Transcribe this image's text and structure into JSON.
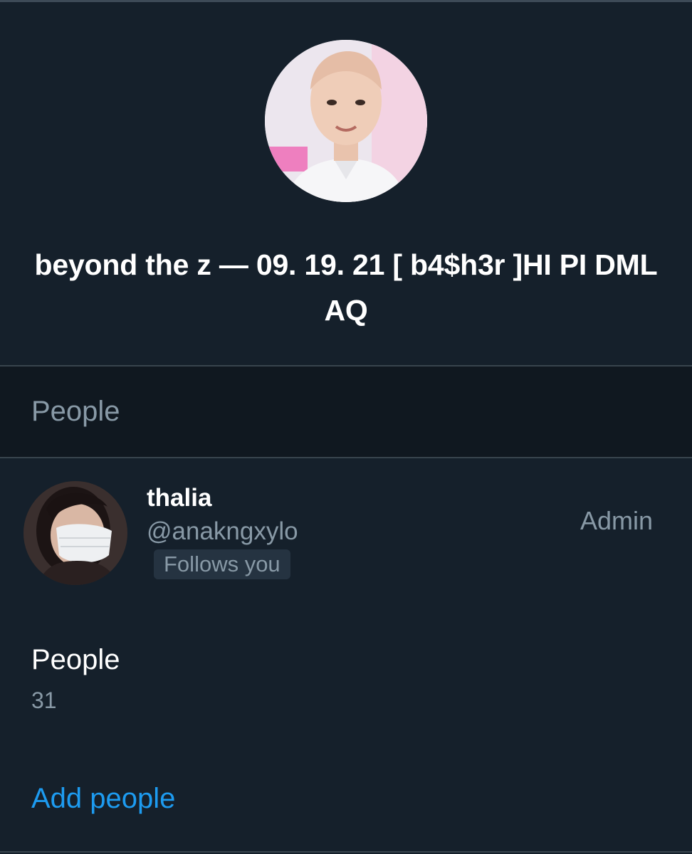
{
  "group": {
    "title": "beyond the z — 09. 19. 21 [ b4$h3r ]HI PI DML AQ"
  },
  "people_section": {
    "header": "People"
  },
  "members": [
    {
      "name": "thalia",
      "handle": "@anakngxylo",
      "badge": "Follows you",
      "role": "Admin"
    }
  ],
  "people_count": {
    "label": "People",
    "value": "31"
  },
  "actions": {
    "add_people": "Add people"
  },
  "colors": {
    "background": "#15202b",
    "section_header_bg": "#101820",
    "secondary_text": "#8899a6",
    "accent": "#1d9bf0",
    "divider": "#38444d"
  }
}
